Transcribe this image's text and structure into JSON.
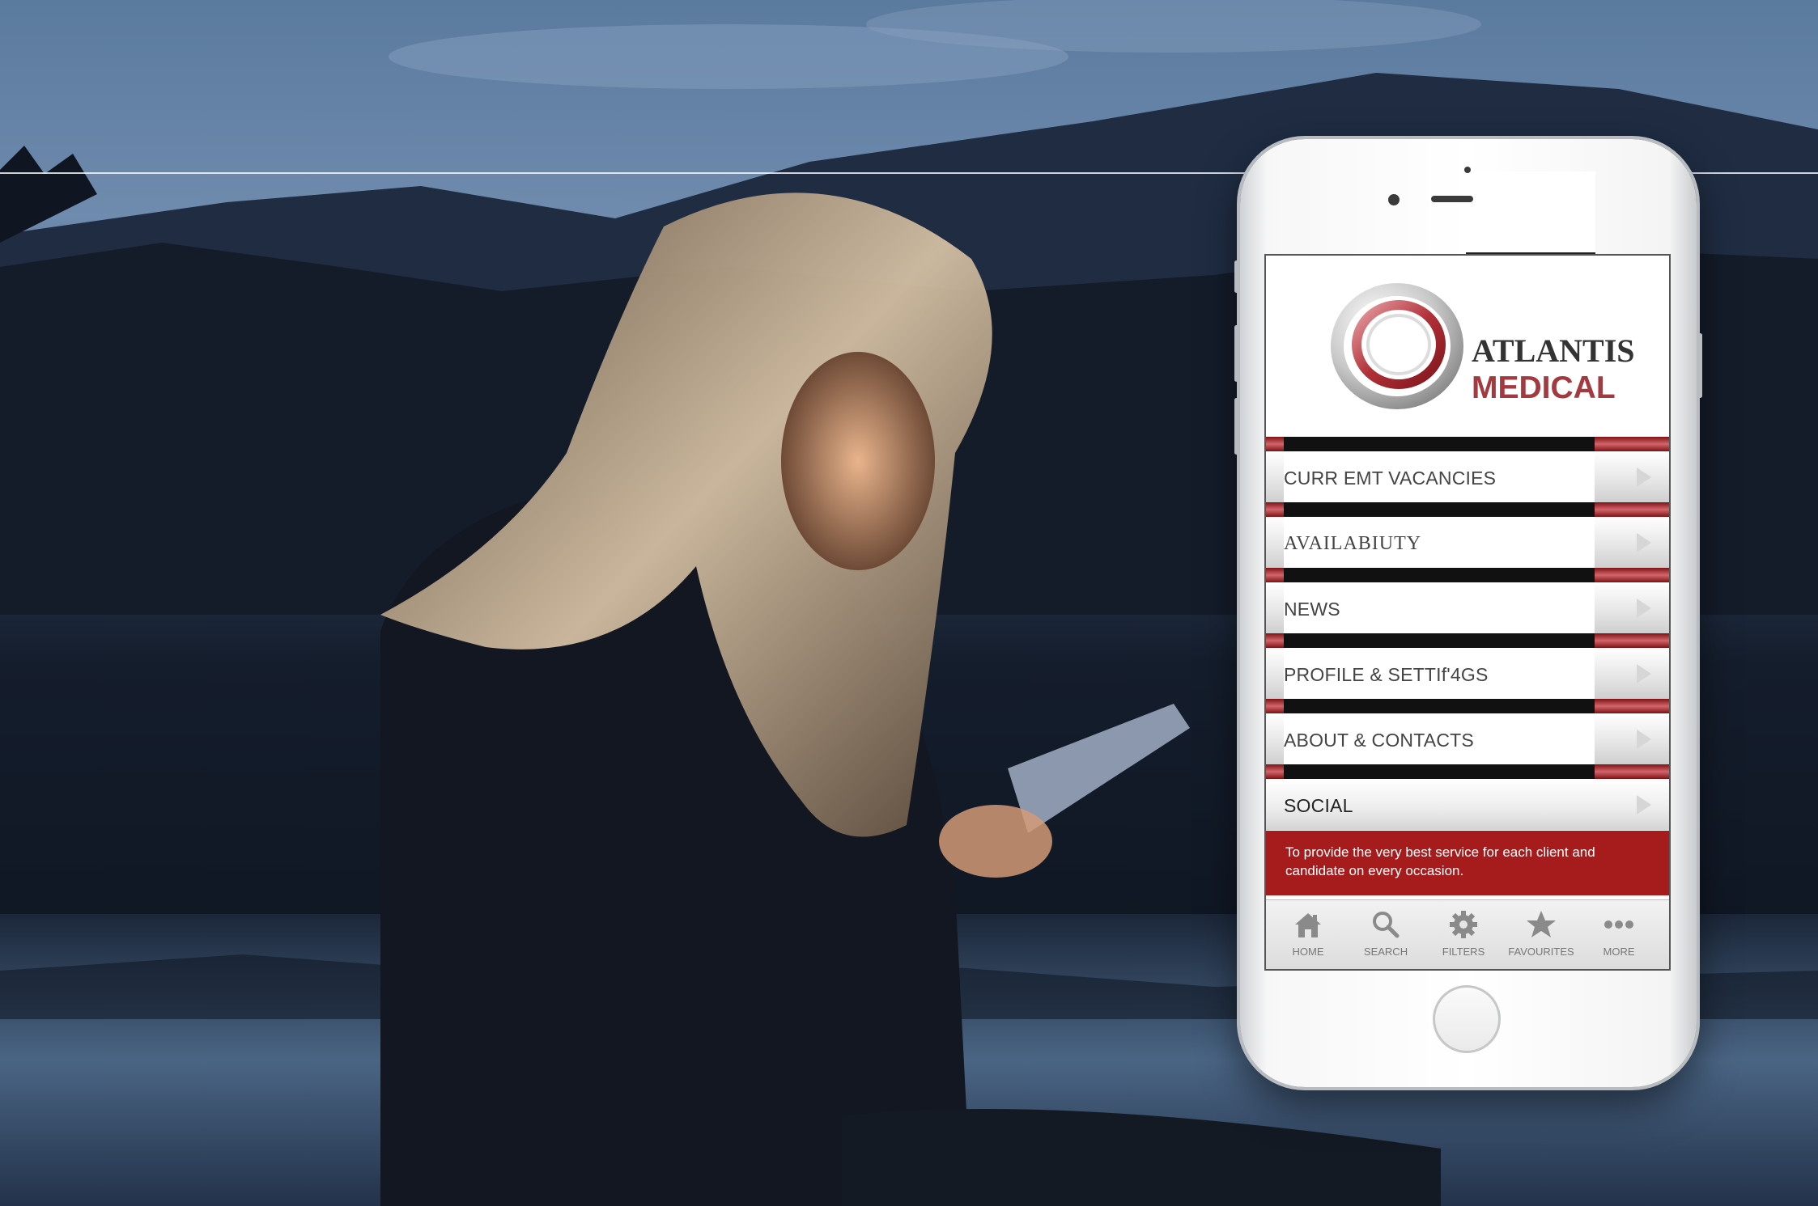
{
  "app": {
    "brand_line1": "ATLANTIS",
    "brand_line2": "MEDICAL"
  },
  "menu": {
    "items": [
      {
        "label": "CURR EMT VACANCIES"
      },
      {
        "label": "AVAILABIUTY"
      },
      {
        "label": "NEWS"
      },
      {
        "label": "PROFILE & SETTIf'4GS"
      },
      {
        "label": "ABOUT & CONTACTS"
      },
      {
        "label": "SOCIAL"
      }
    ]
  },
  "tagline": "To provide the very best service for each client and candidate on every occasion.",
  "tabbar": {
    "tabs": [
      {
        "label": "HOME",
        "icon": "home-icon"
      },
      {
        "label": "SEARCH",
        "icon": "search-icon"
      },
      {
        "label": "FILTERS",
        "icon": "gear-icon"
      },
      {
        "label": "FAVOURITES",
        "icon": "star-icon"
      },
      {
        "label": "MORE",
        "icon": "more-dots-icon"
      }
    ]
  },
  "colors": {
    "accent_red": "#a61c1d",
    "brand_red": "#a33a40",
    "brand_dark": "#333333"
  }
}
